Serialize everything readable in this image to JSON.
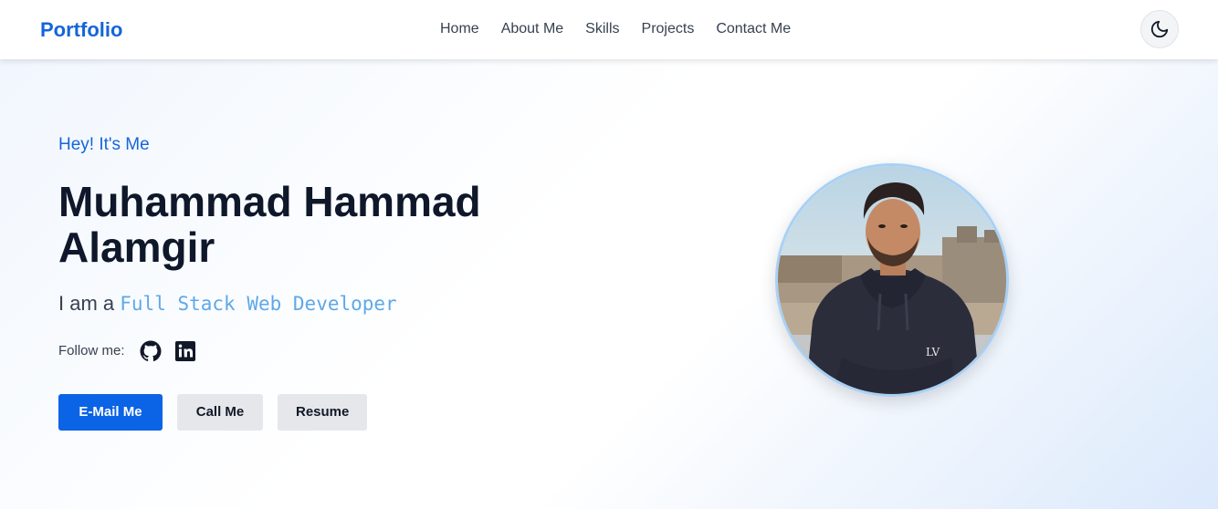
{
  "nav": {
    "brand": "Portfolio",
    "links": [
      "Home",
      "About Me",
      "Skills",
      "Projects",
      "Contact Me"
    ],
    "theme_toggle_icon": "moon-icon"
  },
  "hero": {
    "greeting": "Hey! It's Me",
    "name": "Muhammad Hammad Alamgir",
    "role_prefix": "I am a",
    "role_typed": "Full Stack Web Developer",
    "follow_label": "Follow me:",
    "social_icons": [
      "github-icon",
      "linkedin-icon"
    ],
    "buttons": {
      "email": "E-Mail Me",
      "call": "Call Me",
      "resume": "Resume"
    }
  },
  "colors": {
    "brand": "#1565d8",
    "primary_button": "#0b63e5",
    "secondary_button": "#e5e7eb",
    "typed_text": "#5fa8e8",
    "heading": "#0f172a"
  }
}
